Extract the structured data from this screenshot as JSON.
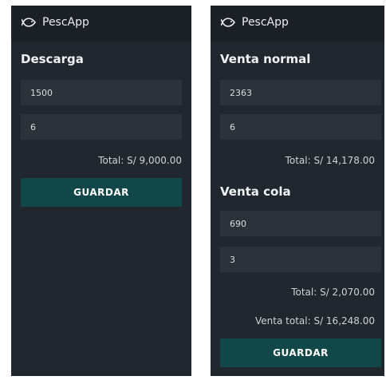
{
  "app": {
    "name": "PescApp"
  },
  "left_screen": {
    "section_title": "Descarga",
    "fields": [
      {
        "value": "1500"
      },
      {
        "value": "6"
      }
    ],
    "total": "Total: S/ 9,000.00",
    "button_label": "GUARDAR"
  },
  "right_screen": {
    "normal": {
      "section_title": "Venta normal",
      "fields": [
        {
          "value": "2363"
        },
        {
          "value": "6"
        }
      ],
      "total": "Total: S/ 14,178.00"
    },
    "cola": {
      "section_title": "Venta cola",
      "fields": [
        {
          "value": "690"
        },
        {
          "value": "3"
        }
      ],
      "total": "Total: S/ 2,070.00"
    },
    "grand_total": "Venta total: S/ 16,248.00",
    "button_label": "GUARDAR"
  },
  "colors": {
    "screen_bg": "#20272e",
    "appbar_bg": "#1a2026",
    "field_bg": "#2b3239",
    "button_bg": "#12474a"
  },
  "icons": {
    "logo": "fish-icon"
  }
}
